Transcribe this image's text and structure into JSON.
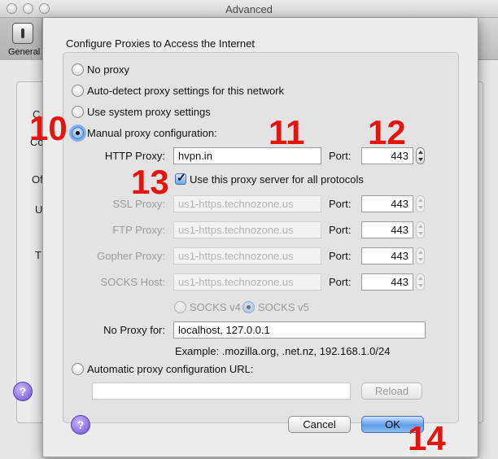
{
  "window": {
    "title": "Advanced",
    "toolbar_general_label": "General"
  },
  "background_stubs": [
    "C",
    "Co",
    "Of",
    "U",
    "T"
  ],
  "sheet": {
    "heading": "Configure Proxies to Access the Internet",
    "radios": {
      "no_proxy": "No proxy",
      "auto_detect": "Auto-detect proxy settings for this network",
      "system": "Use system proxy settings",
      "manual": "Manual proxy configuration:",
      "auto_url": "Automatic proxy configuration URL:"
    },
    "http": {
      "label": "HTTP Proxy:",
      "value": "hvpn.in",
      "port_label": "Port:",
      "port": "443"
    },
    "use_for_all_label": "Use this proxy server for all protocols",
    "ssl": {
      "label": "SSL Proxy:",
      "value": "us1-https.technozone.us",
      "port_label": "Port:",
      "port": "443"
    },
    "ftp": {
      "label": "FTP Proxy:",
      "value": "us1-https.technozone.us",
      "port_label": "Port:",
      "port": "443"
    },
    "gopher": {
      "label": "Gopher Proxy:",
      "value": "us1-https.technozone.us",
      "port_label": "Port:",
      "port": "443"
    },
    "socks": {
      "label": "SOCKS Host:",
      "value": "us1-https.technozone.us",
      "port_label": "Port:",
      "port": "443"
    },
    "socks_v4": "SOCKS v4",
    "socks_v5": "SOCKS v5",
    "no_proxy_for": {
      "label": "No Proxy for:",
      "value": "localhost, 127.0.0.1"
    },
    "example": "Example: .mozilla.org, .net.nz, 192.168.1.0/24",
    "auto_url_value": "",
    "reload": "Reload",
    "cancel": "Cancel",
    "ok": "OK",
    "help_glyph": "?"
  },
  "annotations": [
    "10",
    "11",
    "12",
    "13",
    "14"
  ],
  "colors": {
    "annotation": "#e3150f",
    "focus_ring": "#7fb0ee",
    "default_button": "#5d9be6"
  },
  "icons": [
    "close-traffic-light",
    "minimize-traffic-light",
    "zoom-traffic-light",
    "general-switch-icon",
    "help-icon"
  ]
}
